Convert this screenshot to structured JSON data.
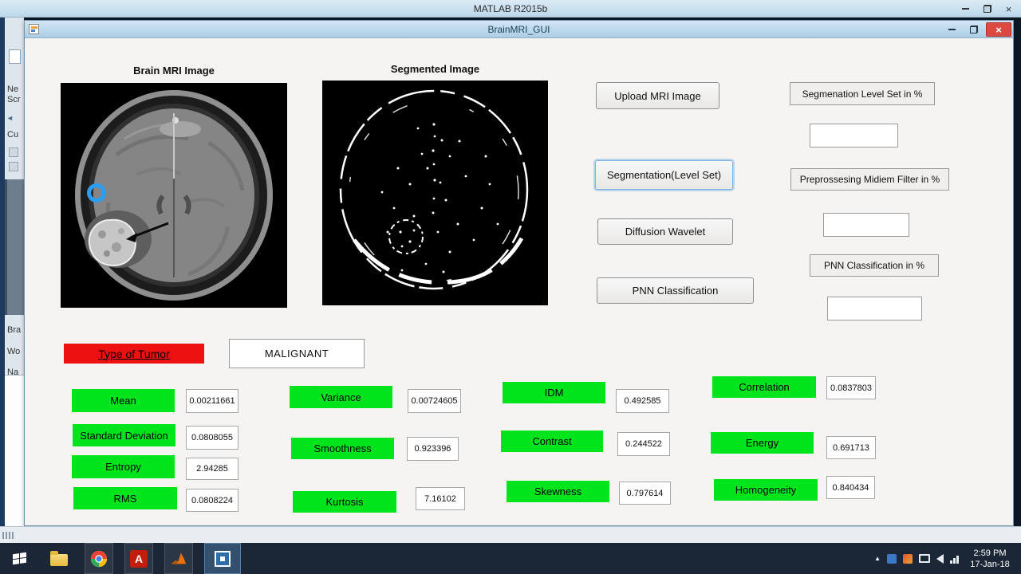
{
  "matlab_window": {
    "title": "MATLAB R2015b"
  },
  "gui_window": {
    "title": "BrainMRI_GUI"
  },
  "panels": {
    "mri_title": "Brain MRI Image",
    "segmented_title": "Segmented Image"
  },
  "actions": {
    "upload": "Upload MRI Image",
    "segmentation": "Segmentation(Level Set)",
    "diffusion": "Diffusion Wavelet",
    "pnn": "PNN Classification"
  },
  "metrics": [
    {
      "label": "Segmenation Level Set in %",
      "value": ""
    },
    {
      "label": "Preprossesing Midiem Filter in %",
      "value": ""
    },
    {
      "label": "PNN Classification in %",
      "value": ""
    }
  ],
  "tumor": {
    "label": "Type of Tumor",
    "result": "MALIGNANT"
  },
  "features": [
    {
      "label": "Mean",
      "value": "0.00211661"
    },
    {
      "label": "Standard Deviation",
      "value": "0.0808055"
    },
    {
      "label": "Entropy",
      "value": "2.94285"
    },
    {
      "label": "RMS",
      "value": "0.0808224"
    },
    {
      "label": "Variance",
      "value": "0.00724605"
    },
    {
      "label": "Smoothness",
      "value": "0.923396"
    },
    {
      "label": "Kurtosis",
      "value": "7.16102"
    },
    {
      "label": "IDM",
      "value": "0.492585"
    },
    {
      "label": "Contrast",
      "value": "0.244522"
    },
    {
      "label": "Skewness",
      "value": "0.797614"
    },
    {
      "label": "Correlation",
      "value": "0.0837803"
    },
    {
      "label": "Energy",
      "value": "0.691713"
    },
    {
      "label": "Homogeneity",
      "value": "0.840434"
    }
  ],
  "ide_strip": {
    "fragments": [
      "Ne",
      "Scr",
      "Cu",
      "Bra",
      "Wo",
      "Na"
    ]
  },
  "taskbar": {
    "time": "2:59 PM",
    "date": "17-Jan-18",
    "apps": [
      "start",
      "file-explorer",
      "chrome",
      "acrobat-reader",
      "matlab",
      "screen-capture"
    ]
  },
  "colors": {
    "green": "#00e41c",
    "red": "#ee1111",
    "taskbar-bg": "#1b2736",
    "titlebar-blue": "#bdd8ea",
    "focus-blue": "#7fb2e0"
  }
}
